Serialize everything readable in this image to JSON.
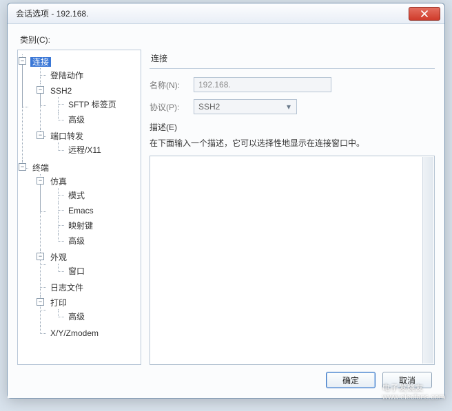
{
  "window": {
    "title": "会话选项 - 192.168."
  },
  "labels": {
    "category": "类别(C):",
    "group_title": "连接",
    "name_label": "名称(N):",
    "protocol_label": "协议(P):",
    "desc_label": "描述(E)",
    "desc_hint": "在下面输入一个描述，它可以选择性地显示在连接窗口中。"
  },
  "fields": {
    "name_value": "192.168.",
    "protocol_value": "SSH2"
  },
  "buttons": {
    "ok": "确定",
    "cancel": "取消"
  },
  "icons": {
    "close": "X",
    "minus": "−",
    "chevron_down": "▾"
  },
  "tree": {
    "n_connection": "连接",
    "n_login_actions": "登陆动作",
    "n_ssh2": "SSH2",
    "n_sftp_tab": "SFTP 标签页",
    "n_ssh2_adv": "高级",
    "n_port_fwd": "端口转发",
    "n_remote_x11": "远程/X11",
    "n_terminal": "终端",
    "n_emulation": "仿真",
    "n_modes": "模式",
    "n_emacs": "Emacs",
    "n_mapkeys": "映射键",
    "n_emu_adv": "高级",
    "n_appearance": "外观",
    "n_window": "窗口",
    "n_logfile": "日志文件",
    "n_print": "打印",
    "n_print_adv": "高级",
    "n_xyz": "X/Y/Zmodem"
  },
  "watermark": {
    "line1": "电子发烧友",
    "line2": "www.elecfans.com"
  }
}
